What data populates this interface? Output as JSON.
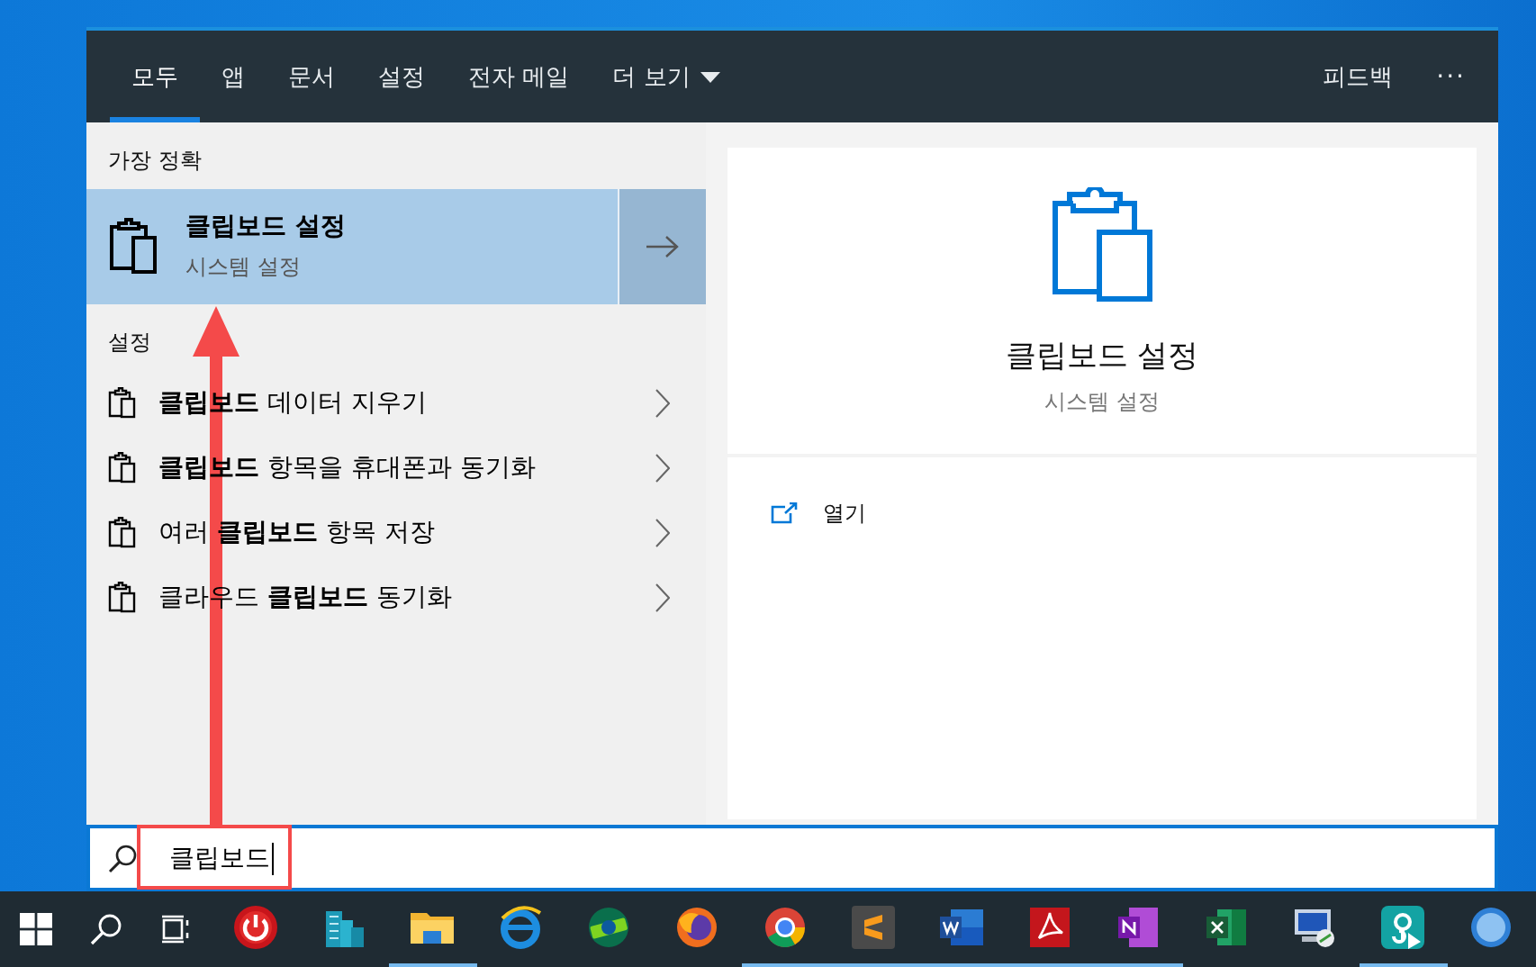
{
  "tabs": [
    {
      "label": "모두",
      "selected": true
    },
    {
      "label": "앱",
      "selected": false
    },
    {
      "label": "문서",
      "selected": false
    },
    {
      "label": "설정",
      "selected": false
    },
    {
      "label": "전자 메일",
      "selected": false
    }
  ],
  "more_menu": {
    "label": "더 보기"
  },
  "header_actions": {
    "feedback": "피드백",
    "more": "···"
  },
  "best_match": {
    "heading": "가장 정확",
    "title": "클립보드 설정",
    "subtitle": "시스템 설정",
    "selected": true
  },
  "settings": {
    "heading": "설정",
    "items": [
      {
        "label": "**클립보드** 데이터 지우기"
      },
      {
        "label": "**클립보드** 항목을 휴대폰과 동기화"
      },
      {
        "label": "여러 **클립보드** 항목 저장"
      },
      {
        "label": "클라우드 **클립보드** 동기화"
      }
    ]
  },
  "preview": {
    "title": "클립보드 설정",
    "subtitle": "시스템 설정",
    "actions": [
      {
        "label": "열기"
      }
    ]
  },
  "search": {
    "value": "클립보드"
  },
  "taskbar": {
    "apps": [
      {
        "kind": "power",
        "running": false
      },
      {
        "kind": "buildings",
        "running": false
      },
      {
        "kind": "folder",
        "running": true
      },
      {
        "kind": "browser-e",
        "running": false
      },
      {
        "kind": "browser-dev",
        "running": false
      },
      {
        "kind": "fox",
        "running": false
      },
      {
        "kind": "chrome",
        "running": true
      },
      {
        "kind": "editor",
        "running": true
      },
      {
        "kind": "word",
        "running": true
      },
      {
        "kind": "pdf",
        "running": true
      },
      {
        "kind": "note",
        "running": true
      },
      {
        "kind": "sheet",
        "running": false
      },
      {
        "kind": "remote",
        "running": false
      },
      {
        "kind": "teal",
        "running": true
      },
      {
        "kind": "globe",
        "running": false
      }
    ]
  }
}
